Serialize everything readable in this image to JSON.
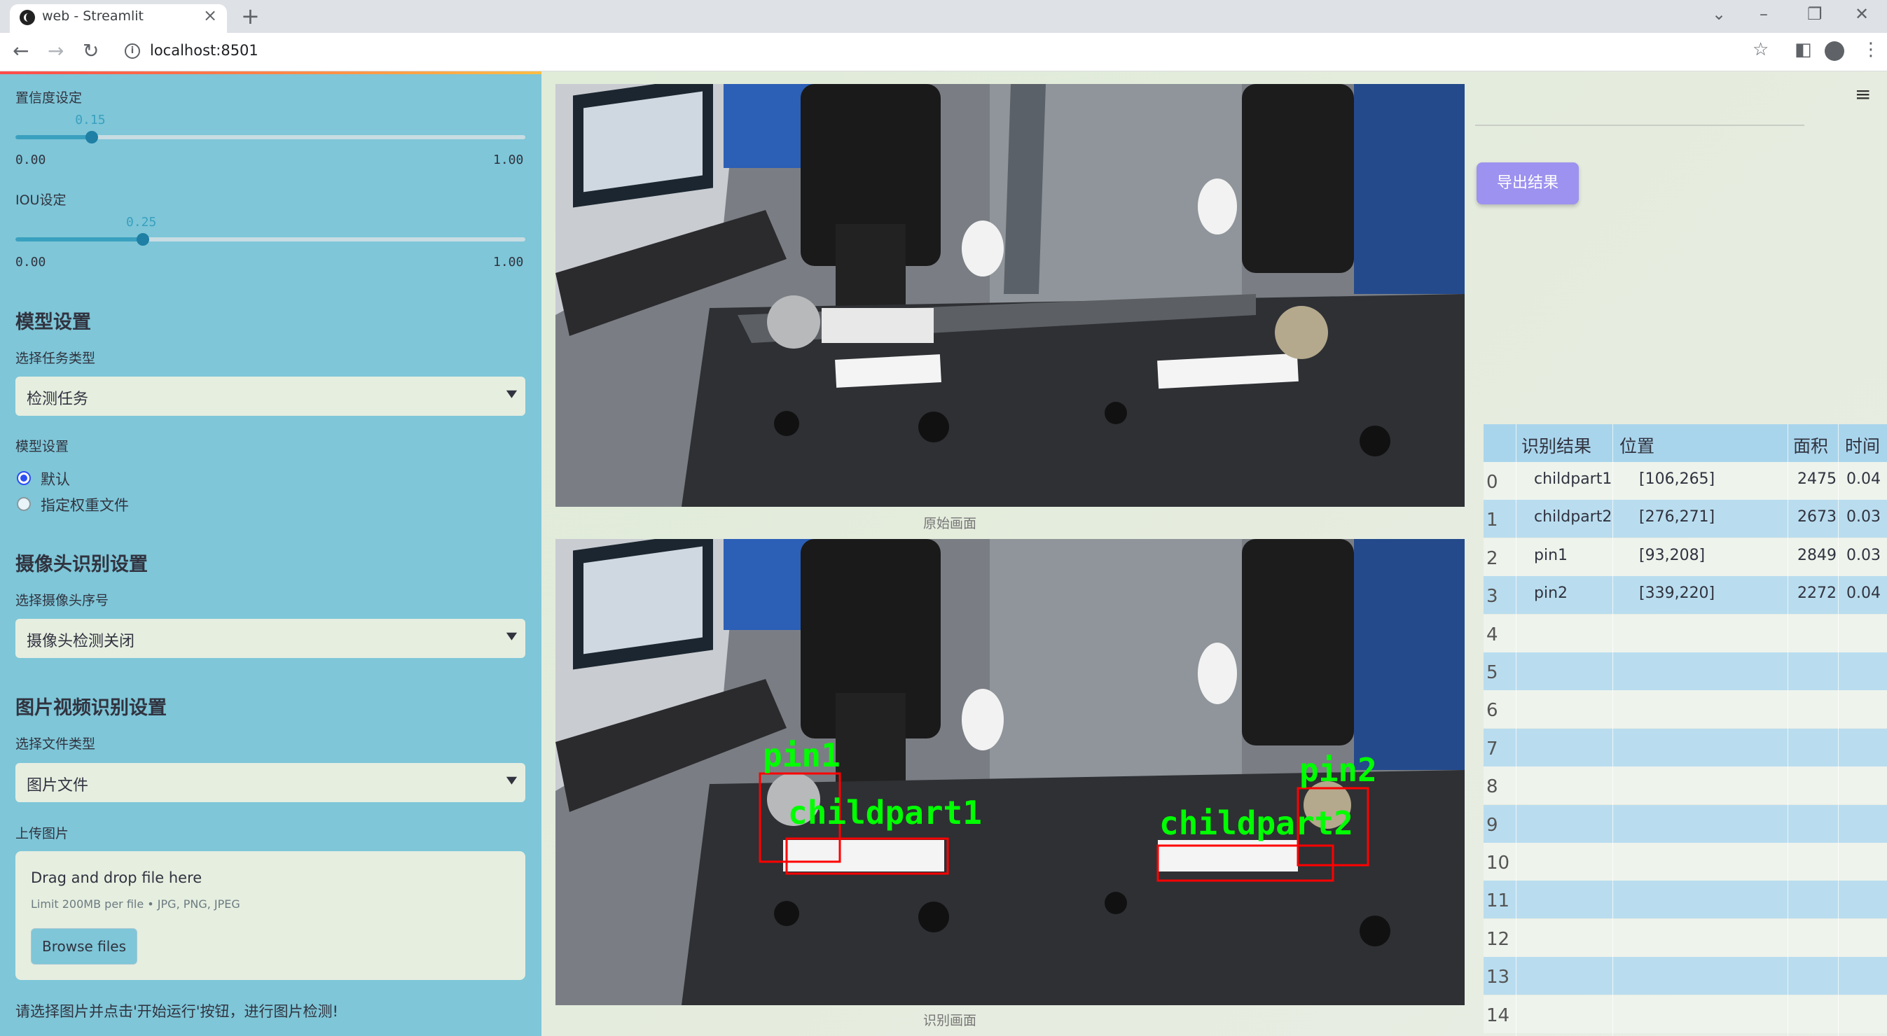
{
  "browser": {
    "tab_title": "web - Streamlit",
    "url": "localhost:8501"
  },
  "sidebar": {
    "conf_label": "置信度设定",
    "conf_value": "0.15",
    "conf_min": "0.00",
    "conf_max": "1.00",
    "conf_fraction": 0.15,
    "iou_label": "IOU设定",
    "iou_value": "0.25",
    "iou_min": "0.00",
    "iou_max": "1.00",
    "iou_fraction": 0.25,
    "model_header": "模型设置",
    "task_label": "选择任务类型",
    "task_value": "检测任务",
    "model_label": "模型设置",
    "radio_default": "默认",
    "radio_custom": "指定权重文件",
    "camera_header": "摄像头识别设置",
    "camera_label": "选择摄像头序号",
    "camera_value": "摄像头检测关闭",
    "media_header": "图片视频识别设置",
    "filetype_label": "选择文件类型",
    "filetype_value": "图片文件",
    "upload_label": "上传图片",
    "drop_title": "Drag and drop file here",
    "drop_limit": "Limit 200MB per file • JPG, PNG, JPEG",
    "browse_label": "Browse files",
    "hint": "请选择图片并点击'开始运行'按钮，进行图片检测!"
  },
  "main": {
    "caption_original": "原始画面",
    "caption_detect": "识别画面",
    "export_label": "导出结果",
    "detections": [
      {
        "label": "pin1",
        "color": "#00ff00"
      },
      {
        "label": "childpart1",
        "color": "#00ff00"
      },
      {
        "label": "pin2",
        "color": "#00ff00"
      },
      {
        "label": "childpart2",
        "color": "#00ff00"
      }
    ]
  },
  "table": {
    "headers": [
      "识别结果",
      "位置",
      "面积",
      "时间"
    ],
    "rows": [
      {
        "idx": "0",
        "result": "childpart1",
        "pos": "[106,265]",
        "area": "2475",
        "time": "0.04"
      },
      {
        "idx": "1",
        "result": "childpart2",
        "pos": "[276,271]",
        "area": "2673",
        "time": "0.03"
      },
      {
        "idx": "2",
        "result": "pin1",
        "pos": "[93,208]",
        "area": "2849",
        "time": "0.03"
      },
      {
        "idx": "3",
        "result": "pin2",
        "pos": "[339,220]",
        "area": "2272",
        "time": "0.04"
      },
      {
        "idx": "4",
        "result": "",
        "pos": "",
        "area": "",
        "time": ""
      },
      {
        "idx": "5",
        "result": "",
        "pos": "",
        "area": "",
        "time": ""
      },
      {
        "idx": "6",
        "result": "",
        "pos": "",
        "area": "",
        "time": ""
      },
      {
        "idx": "7",
        "result": "",
        "pos": "",
        "area": "",
        "time": ""
      },
      {
        "idx": "8",
        "result": "",
        "pos": "",
        "area": "",
        "time": ""
      },
      {
        "idx": "9",
        "result": "",
        "pos": "",
        "area": "",
        "time": ""
      },
      {
        "idx": "10",
        "result": "",
        "pos": "",
        "area": "",
        "time": ""
      },
      {
        "idx": "11",
        "result": "",
        "pos": "",
        "area": "",
        "time": ""
      },
      {
        "idx": "12",
        "result": "",
        "pos": "",
        "area": "",
        "time": ""
      },
      {
        "idx": "13",
        "result": "",
        "pos": "",
        "area": "",
        "time": ""
      },
      {
        "idx": "14",
        "result": "",
        "pos": "",
        "area": "",
        "time": ""
      }
    ]
  },
  "colors": {
    "sidebar_bg": "#7ec6d8",
    "main_bg": "#e4ebdd",
    "accent": "#9d92ef",
    "slider": "#3aa0bf",
    "detect_box": "#ff0000",
    "detect_text": "#00ff00"
  }
}
